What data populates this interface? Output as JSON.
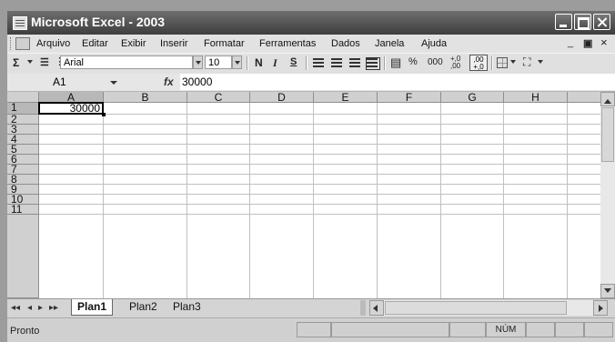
{
  "window": {
    "title": "Microsoft Excel - 2003"
  },
  "menu": {
    "items": [
      "Arquivo",
      "Editar",
      "Exibir",
      "Inserir",
      "Formatar",
      "Ferramentas",
      "Dados",
      "Janela",
      "Ajuda"
    ],
    "mdi_min": "_",
    "mdi_restore": "ǿ",
    "mdi_close": "×"
  },
  "toolbar": {
    "autosum": "Σ",
    "font_name": "Arial",
    "font_size": "10",
    "bold": "N",
    "italic": "I",
    "underline": "S",
    "percent": "%",
    "thousands": "000",
    "inc_decimal": "+,0\n,00",
    "dec_decimal": ",00\n+,0"
  },
  "formula_bar": {
    "name_box": "A1",
    "fx": "fx",
    "value": "30000"
  },
  "grid": {
    "columns": [
      "A",
      "B",
      "C",
      "D",
      "E",
      "F",
      "G",
      "H"
    ],
    "rows": [
      "1",
      "2",
      "3",
      "4",
      "5",
      "6",
      "7",
      "8",
      "9",
      "10",
      "11"
    ],
    "active_cell": "A1",
    "cell_A1": "30000"
  },
  "sheets": {
    "nav": [
      "◂◂",
      "◂",
      "▸",
      "▸▸"
    ],
    "tabs": [
      "Plan1",
      "Plan2",
      "Plan3"
    ],
    "active": "Plan1"
  },
  "status": {
    "left": "Pronto",
    "num": "NÚM"
  }
}
